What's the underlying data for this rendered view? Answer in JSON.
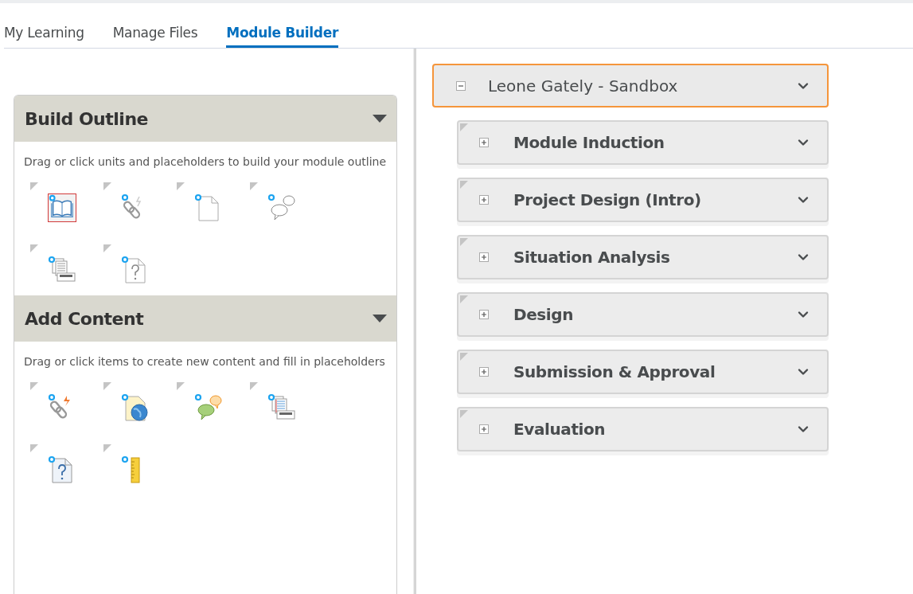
{
  "tabs": [
    {
      "label": "My Learning",
      "selected": false
    },
    {
      "label": "Manage Files",
      "selected": false
    },
    {
      "label": "Module Builder",
      "selected": true
    }
  ],
  "panels": [
    {
      "title": "Build Outline",
      "description": "Drag or click units and placeholders to build your module outline",
      "tools": [
        {
          "kind": "book",
          "selected": true
        },
        {
          "kind": "link",
          "selected": false
        },
        {
          "kind": "document",
          "selected": false
        },
        {
          "kind": "bubbles",
          "selected": false
        },
        {
          "kind": "filing",
          "selected": false
        },
        {
          "kind": "question",
          "selected": false
        }
      ]
    },
    {
      "title": "Add Content",
      "description": "Drag or click items to create new content and fill in placeholders",
      "tools": [
        {
          "kind": "link-color",
          "selected": false
        },
        {
          "kind": "web-page",
          "selected": false
        },
        {
          "kind": "bubbles-color",
          "selected": false
        },
        {
          "kind": "filing-color",
          "selected": false
        },
        {
          "kind": "question-color",
          "selected": false
        },
        {
          "kind": "ruler",
          "selected": false
        }
      ]
    }
  ],
  "tree": {
    "title": "Leone Gately - Sandbox",
    "expanded": true,
    "selected": true,
    "children": [
      {
        "title": "Module Induction",
        "expanded": false,
        "selected": false
      },
      {
        "title": "Project Design (Intro)",
        "expanded": false,
        "selected": false
      },
      {
        "title": "Situation Analysis",
        "expanded": false,
        "selected": false
      },
      {
        "title": "Design",
        "expanded": false,
        "selected": false
      },
      {
        "title": "Submission & Approval",
        "expanded": false,
        "selected": false
      },
      {
        "title": "Evaluation",
        "expanded": false,
        "selected": false
      }
    ]
  }
}
